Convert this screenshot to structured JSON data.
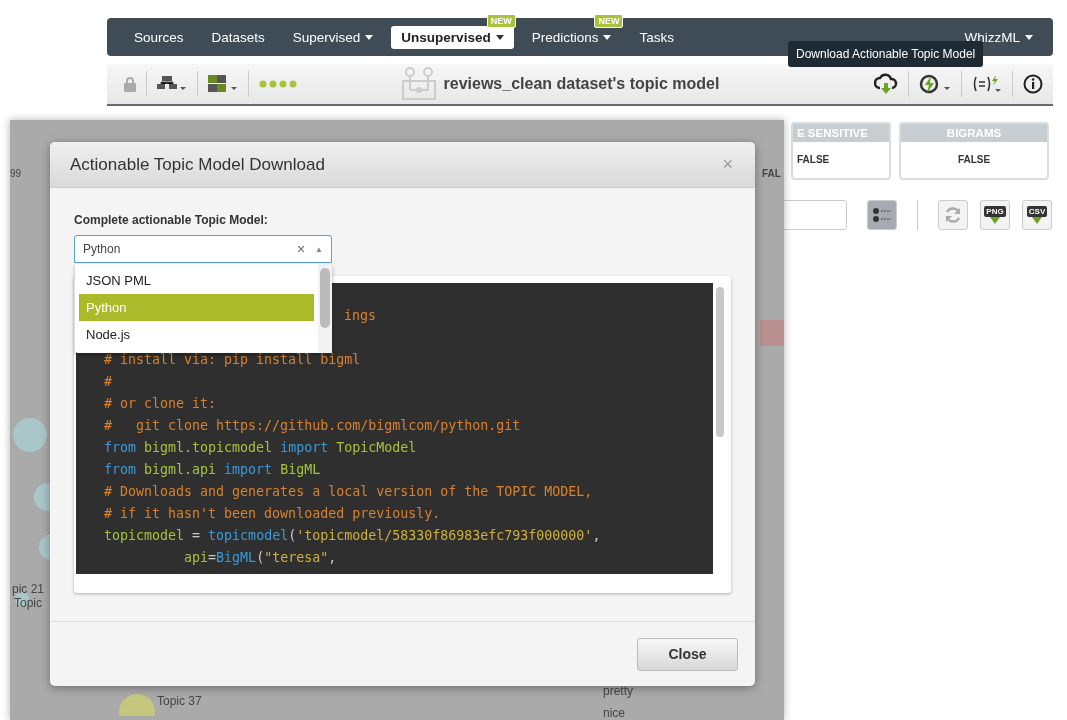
{
  "nav": {
    "items": [
      {
        "label": "Sources",
        "selected": false,
        "caret": false
      },
      {
        "label": "Datasets",
        "selected": false,
        "caret": false
      },
      {
        "label": "Supervised",
        "selected": false,
        "caret": true
      },
      {
        "label": "Unsupervised",
        "selected": true,
        "caret": true,
        "badge": "NEW"
      },
      {
        "label": "Predictions",
        "selected": false,
        "caret": true,
        "badge": "NEW"
      },
      {
        "label": "Tasks",
        "selected": false,
        "caret": false
      }
    ],
    "right_item": {
      "label": "WhizzML",
      "caret": true
    }
  },
  "toolbar": {
    "title": "reviews_clean dataset's topic model",
    "tooltip": "Download Actionable Topic Model"
  },
  "settings_cards": [
    {
      "header": "E SENSITIVE",
      "value": "FALSE"
    },
    {
      "header": "BIGRAMS",
      "value": "FALSE"
    }
  ],
  "export_buttons": [
    "PNG",
    "CSV"
  ],
  "background_texts": {
    "left_count": "99",
    "right_value": "FAL",
    "topic_label_a": "pic 21",
    "topic_label_b": "Topic",
    "topic_label_c": "Topic 37",
    "term_a": "pretty",
    "term_b": "nice"
  },
  "modal": {
    "title": "Actionable Topic Model Download",
    "close_symbol": "×",
    "field_label": "Complete actionable Topic Model:",
    "select": {
      "value": "Python",
      "clear_symbol": "×",
      "arrow_symbol": "▲",
      "open": true,
      "options": [
        {
          "label": "JSON PML",
          "selected": false
        },
        {
          "label": "Python",
          "selected": true
        },
        {
          "label": "Node.js",
          "selected": false
        }
      ]
    },
    "code_fragment": "ings",
    "code_lines": [
      [
        {
          "kind": "comment",
          "text": "# install via: pip install bigml"
        }
      ],
      [
        {
          "kind": "comment",
          "text": "#"
        }
      ],
      [
        {
          "kind": "comment",
          "text": "# or clone it:"
        }
      ],
      [
        {
          "kind": "comment",
          "text": "#   git clone https://github.com/bigmlcom/python.git"
        }
      ],
      [
        {
          "kind": "keyword",
          "text": "from "
        },
        {
          "kind": "name",
          "text": "bigml.topicmodel "
        },
        {
          "kind": "keyword",
          "text": "import "
        },
        {
          "kind": "name",
          "text": "TopicModel"
        }
      ],
      [
        {
          "kind": "keyword",
          "text": "from "
        },
        {
          "kind": "name",
          "text": "bigml.api "
        },
        {
          "kind": "keyword",
          "text": "import "
        },
        {
          "kind": "name",
          "text": "BigML"
        }
      ],
      [
        {
          "kind": "comment",
          "text": "# Downloads and generates a local version of the TOPIC MODEL,"
        }
      ],
      [
        {
          "kind": "comment",
          "text": "# if it hasn't been downloaded previously."
        }
      ],
      [
        {
          "kind": "name",
          "text": "topicmodel"
        },
        {
          "kind": "plain",
          "text": " = "
        },
        {
          "kind": "keyword",
          "text": "topicmodel"
        },
        {
          "kind": "plain",
          "text": "("
        },
        {
          "kind": "string",
          "text": "'topicmodel/58330f86983efc793f000000'"
        },
        {
          "kind": "plain",
          "text": ","
        }
      ],
      [
        {
          "kind": "argument",
          "text": "api"
        },
        {
          "kind": "plain",
          "text": "="
        },
        {
          "kind": "keyword",
          "text": "BigML"
        },
        {
          "kind": "plain",
          "text": "("
        },
        {
          "kind": "string",
          "text": "\"teresa\""
        },
        {
          "kind": "plain",
          "text": ","
        }
      ]
    ],
    "close_button": "Close"
  }
}
